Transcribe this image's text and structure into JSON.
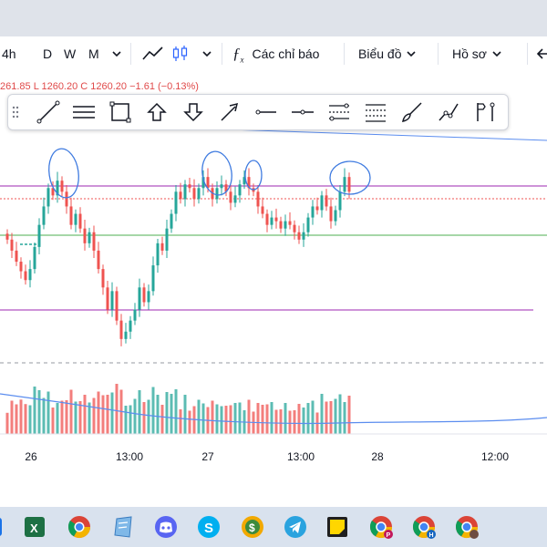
{
  "toolbar": {
    "intervals": [
      "4h",
      "D",
      "W",
      "M"
    ],
    "indicators_label": "Các chỉ báo",
    "chart_type_label": "Biểu đồ",
    "profile_label": "Hồ sơ"
  },
  "legend": {
    "ohlc_text": "261.85  L 1260.20  C 1260.20  −1.61 (−0.13%)"
  },
  "time_axis": [
    "26",
    "13:00",
    "27",
    "13:00",
    "28",
    "12:00"
  ],
  "drawing_tools": [
    "trend-line-icon",
    "parallel-channel-icon",
    "rectangle-icon",
    "arrow-up-icon",
    "arrow-down-icon",
    "arrow-icon",
    "horizontal-ray-icon",
    "horizontal-line-icon",
    "fib-retracement-icon",
    "fib-extension-icon",
    "brush-icon",
    "path-icon",
    "anchored-vwap-icon"
  ],
  "taskbar": [
    "excel-icon",
    "chrome-icon",
    "notes-icon",
    "discord-icon",
    "skype-icon",
    "metatrader-icon",
    "telegram-icon",
    "sticky-notes-icon",
    "chrome-profile-p-icon",
    "chrome-profile-h-icon",
    "chrome-profile-icon"
  ],
  "colors": {
    "up": "#26a69a",
    "down": "#ef5350",
    "purple_line": "#9c27b0",
    "green_line": "#4caf50",
    "volume_ma": "#5b8def",
    "annotation": "#3f7be0"
  },
  "chart_data": {
    "type": "candlestick",
    "title": "",
    "xlabel": "",
    "ylabel": "",
    "x_ticks": [
      "26",
      "13:00",
      "27",
      "13:00",
      "28",
      "12:00"
    ],
    "close": [
      1269.5,
      1268.0,
      1266.5,
      1265.2,
      1264.0,
      1265.5,
      1268.5,
      1271.5,
      1274.0,
      1276.5,
      1275.5,
      1277.5,
      1276.0,
      1274.0,
      1271.5,
      1273.0,
      1271.0,
      1269.0,
      1270.5,
      1268.0,
      1265.5,
      1263.0,
      1260.0,
      1262.5,
      1258.5,
      1256.0,
      1257.0,
      1258.5,
      1260.0,
      1263.0,
      1261.0,
      1262.5,
      1266.0,
      1269.0,
      1268.0,
      1271.0,
      1273.0,
      1276.0,
      1275.0,
      1277.0,
      1276.5,
      1275.0,
      1276.5,
      1278.0,
      1276.5,
      1275.0,
      1276.5,
      1277.0,
      1276.0,
      1274.5,
      1275.5,
      1277.0,
      1278.0,
      1276.5,
      1276.0,
      1274.0,
      1273.0,
      1271.5,
      1272.5,
      1272.0,
      1271.0,
      1272.0,
      1271.5,
      1270.5,
      1269.5,
      1270.5,
      1272.5,
      1274.0,
      1273.5,
      1275.5,
      1274.0,
      1272.0,
      1273.5,
      1276.0,
      1278.0,
      1276.0
    ]
  }
}
